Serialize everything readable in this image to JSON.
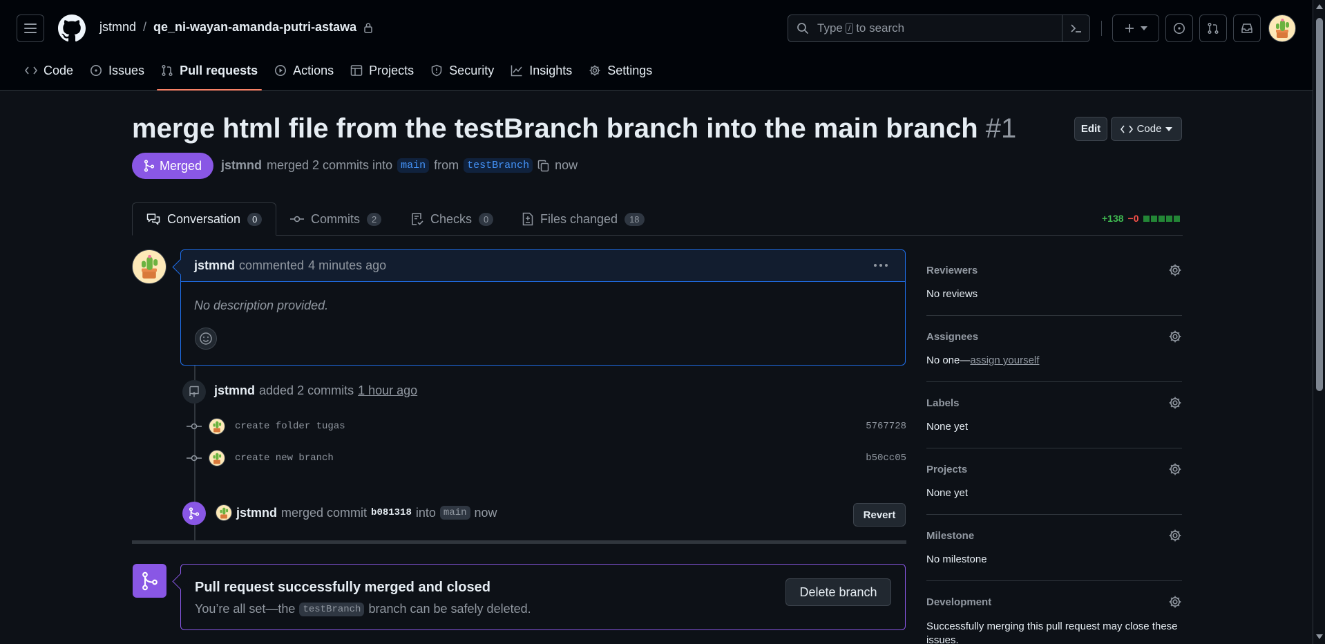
{
  "header": {
    "owner": "jstmnd",
    "separator": "/",
    "repo": "qe_ni-wayan-amanda-putri-astawa",
    "search": {
      "prefix": "Type",
      "key": "/",
      "suffix": "to search"
    }
  },
  "repo_nav": {
    "tabs": [
      {
        "label": "Code",
        "icon": "code-icon"
      },
      {
        "label": "Issues",
        "icon": "issue-icon"
      },
      {
        "label": "Pull requests",
        "icon": "pull-request-icon",
        "active": true
      },
      {
        "label": "Actions",
        "icon": "play-icon"
      },
      {
        "label": "Projects",
        "icon": "table-icon"
      },
      {
        "label": "Security",
        "icon": "shield-icon"
      },
      {
        "label": "Insights",
        "icon": "graph-icon"
      },
      {
        "label": "Settings",
        "icon": "gear-icon"
      }
    ]
  },
  "pr": {
    "title": "merge html file from the testBranch branch into the main branch",
    "number": "#1",
    "edit_label": "Edit",
    "code_label": "Code",
    "state": "Merged",
    "author": "jstmnd",
    "merged_text": "merged 2 commits into",
    "base_branch": "main",
    "from_text": "from",
    "head_branch": "testBranch",
    "time": "now"
  },
  "tabs": {
    "conversation": {
      "label": "Conversation",
      "count": "0"
    },
    "commits": {
      "label": "Commits",
      "count": "2"
    },
    "checks": {
      "label": "Checks",
      "count": "0"
    },
    "files": {
      "label": "Files changed",
      "count": "18"
    }
  },
  "diffstat": {
    "additions": "+138",
    "deletions": "−0",
    "blocks": 5
  },
  "comment": {
    "author": "jstmnd",
    "action": "commented",
    "time": "4 minutes ago",
    "body": "No description provided."
  },
  "commits_event": {
    "author": "jstmnd",
    "action": "added 2 commits",
    "time": "1 hour ago",
    "commits": [
      {
        "message": "create folder tugas",
        "sha": "5767728"
      },
      {
        "message": "create new branch",
        "sha": "b50cc05"
      }
    ]
  },
  "merge_event": {
    "author": "jstmnd",
    "action": "merged commit",
    "sha": "b081318",
    "into": "into",
    "branch": "main",
    "time": "now",
    "revert_label": "Revert"
  },
  "merged_box": {
    "title": "Pull request successfully merged and closed",
    "sub_prefix": "You’re all set—the",
    "branch": "testBranch",
    "sub_suffix": "branch can be safely deleted.",
    "delete_label": "Delete branch"
  },
  "sidebar": {
    "reviewers": {
      "label": "Reviewers",
      "value": "No reviews"
    },
    "assignees": {
      "label": "Assignees",
      "value_prefix": "No one—",
      "link": "assign yourself"
    },
    "labels": {
      "label": "Labels",
      "value": "None yet"
    },
    "projects": {
      "label": "Projects",
      "value": "None yet"
    },
    "milestone": {
      "label": "Milestone",
      "value": "No milestone"
    },
    "development": {
      "label": "Development",
      "value": "Successfully merging this pull request may close these issues."
    }
  },
  "colors": {
    "merged": "#8957e5",
    "accent_underline": "#f78166",
    "diff_add": "#3fb950",
    "diff_del": "#f85149",
    "link": "#4493f8"
  }
}
